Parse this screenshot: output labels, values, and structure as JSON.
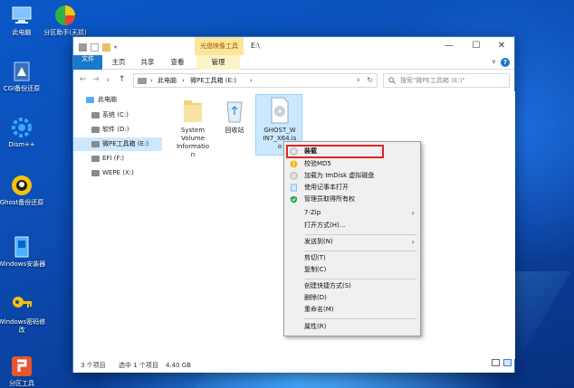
{
  "desktop": {
    "icons": [
      {
        "label": "此电脑",
        "icon": "computer-icon"
      },
      {
        "label": "分区助手(无损)",
        "icon": "partition-assistant-icon"
      },
      {
        "label": "CGI备份还原",
        "icon": "cgi-backup-icon"
      },
      {
        "label": "Dism++",
        "icon": "dism-gear-icon"
      },
      {
        "label": "Ghost备份还原",
        "icon": "ghost-icon"
      },
      {
        "label": "Windows安装器",
        "icon": "windows-installer-icon"
      },
      {
        "label": "Windows密码修改",
        "icon": "password-key-icon"
      },
      {
        "label": "分区工具",
        "icon": "partition-tool-icon"
      }
    ]
  },
  "window": {
    "context_tab_header": "光盘映像工具",
    "title": "E:\\",
    "controls": {
      "minimize": "—",
      "maximize": "☐",
      "close": "✕"
    }
  },
  "ribbon": {
    "tabs": [
      "文件",
      "主页",
      "共享",
      "查看",
      "管理"
    ],
    "collapse": "∨",
    "help": "?"
  },
  "address": {
    "back": "←",
    "forward": "→",
    "up": "↑",
    "crumbs": [
      "›",
      "此电脑",
      "›",
      "微PE工具箱 (E:)",
      "›"
    ],
    "dropdown": "∨",
    "refresh": "↻",
    "search_placeholder": "搜索\"微PE工具箱 (E:)\""
  },
  "navpane": {
    "items": [
      {
        "label": "此电脑",
        "icon": "computer-icon"
      },
      {
        "label": "系统 (C:)",
        "icon": "drive-icon"
      },
      {
        "label": "软件 (D:)",
        "icon": "drive-icon"
      },
      {
        "label": "微PE工具箱 (E:)",
        "icon": "drive-icon"
      },
      {
        "label": "EFI (F:)",
        "icon": "drive-icon"
      },
      {
        "label": "WEPE (X:)",
        "icon": "drive-icon"
      }
    ]
  },
  "files": [
    {
      "label": "System Volume Information",
      "lines": [
        "System",
        "Volume",
        "Informatio",
        "n"
      ],
      "icon": "folder-icon"
    },
    {
      "label": "回收站",
      "lines": [
        "回收站"
      ],
      "icon": "recycle-bin-icon"
    },
    {
      "label": "GHOST_WIN7_X64.iso",
      "lines": [
        "GHOST_W",
        "IN7_X64.is",
        "o"
      ],
      "icon": "disc-image-icon"
    }
  ],
  "status": {
    "count": "3 个项目",
    "selected": "选中 1 个项目",
    "size": "4.40 GB"
  },
  "context_menu": {
    "items": [
      {
        "label": "装载",
        "icon": "disc-icon"
      },
      {
        "label": "校验MD5",
        "icon": "md5-icon"
      },
      {
        "label": "加载为 ImDisk 虚拟磁盘",
        "icon": "imdisk-icon"
      },
      {
        "label": "使用记事本打开",
        "icon": "notepad-icon"
      },
      {
        "label": "管理员取得所有权",
        "icon": "shield-icon"
      },
      {
        "label": "7-Zip",
        "submenu": "›"
      },
      {
        "label": "打开方式(H)...",
        "submenu": ""
      },
      {
        "label": "发送到(N)",
        "submenu": "›"
      },
      {
        "label": "剪切(T)"
      },
      {
        "label": "复制(C)"
      },
      {
        "label": "创建快捷方式(S)"
      },
      {
        "label": "删除(D)"
      },
      {
        "label": "重命名(M)"
      },
      {
        "label": "属性(R)"
      }
    ]
  },
  "colors": {
    "accent": "#1979ca",
    "highlight": "#e02424",
    "selection": "#cce8ff",
    "desktop": "#0c4fb8"
  }
}
